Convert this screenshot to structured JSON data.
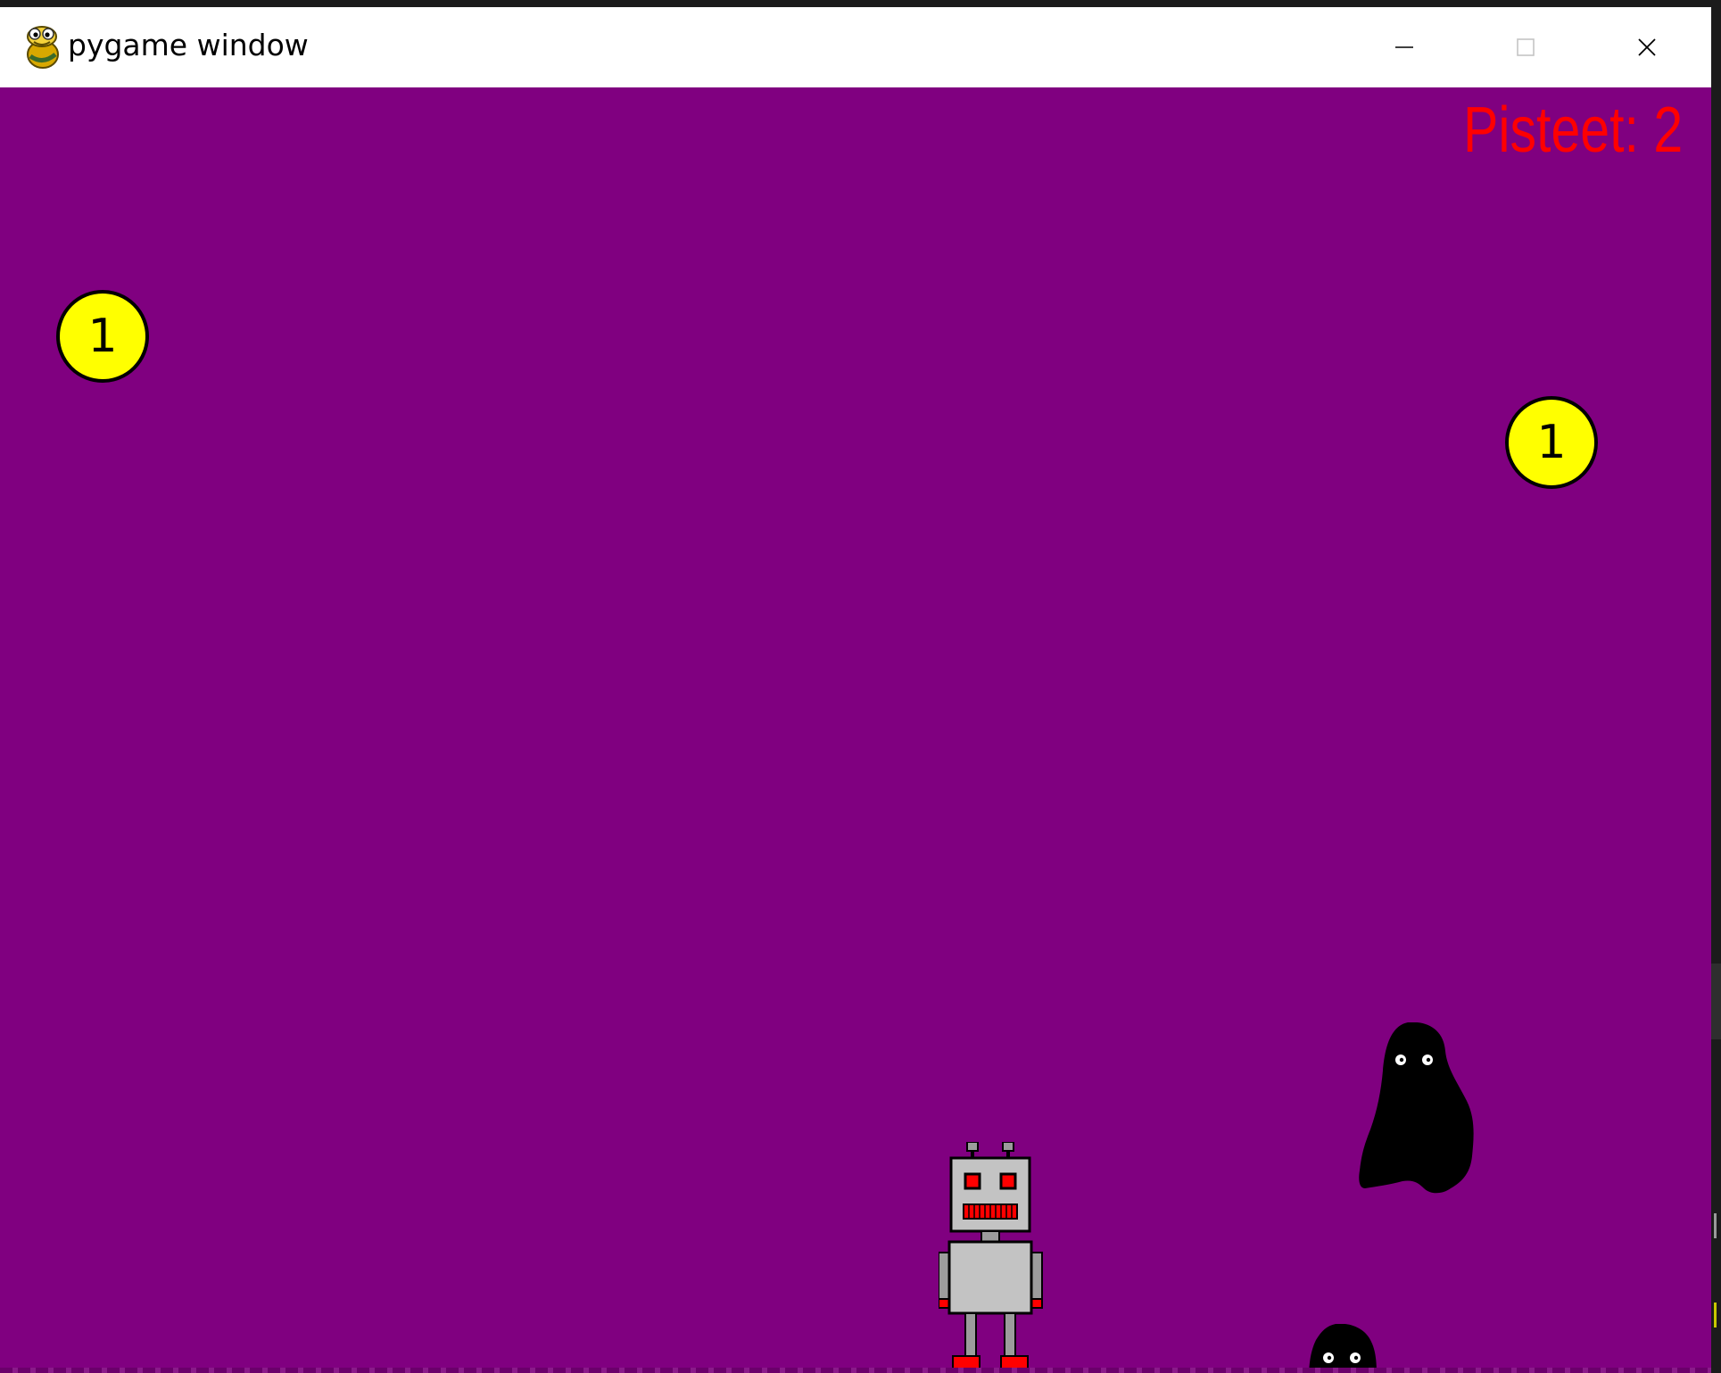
{
  "window": {
    "title": "pygame window",
    "app_icon": "pygame-snake-icon",
    "controls": {
      "minimize_icon": "minimize-icon",
      "maximize_icon": "maximize-icon",
      "close_icon": "close-icon"
    }
  },
  "game": {
    "background_color": "#800080",
    "score_text": "Pisteet: 2",
    "score_color": "#ff0000",
    "coins": [
      {
        "label": "1",
        "color": "#ffff00"
      },
      {
        "label": "1",
        "color": "#ffff00"
      }
    ],
    "player": {
      "sprite": "robot-icon"
    },
    "monsters": [
      {
        "sprite": "monster-icon"
      },
      {
        "sprite": "monster-icon"
      }
    ]
  }
}
